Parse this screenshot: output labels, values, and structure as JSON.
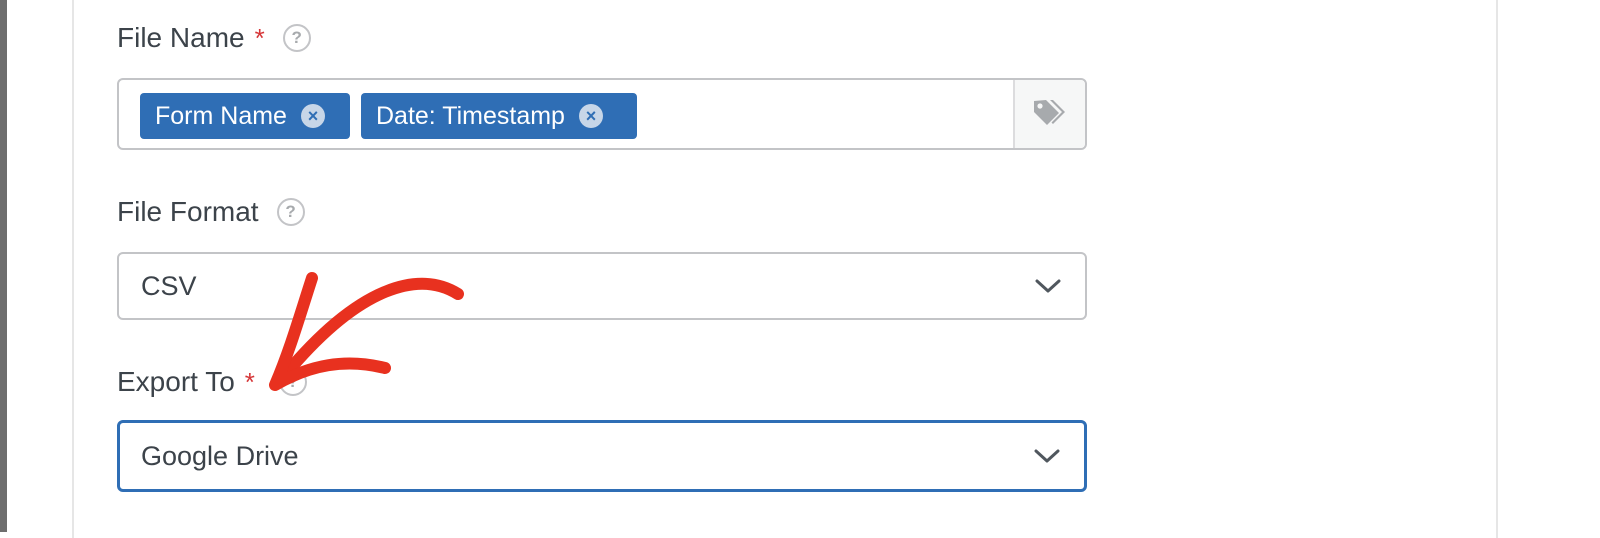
{
  "file_name": {
    "label": "File Name",
    "required_mark": "*",
    "help_icon": "question-circle-icon",
    "tags": [
      {
        "label": "Form Name",
        "remove_icon": "close-circle-icon"
      },
      {
        "label": "Date: Timestamp",
        "remove_icon": "close-circle-icon"
      }
    ],
    "smart_tag_icon": "tag-icon"
  },
  "file_format": {
    "label": "File Format",
    "help_icon": "question-circle-icon",
    "selected": "CSV",
    "dropdown_icon": "chevron-down-icon"
  },
  "export_to": {
    "label": "Export To",
    "required_mark": "*",
    "help_icon": "question-circle-icon",
    "selected": "Google Drive",
    "dropdown_icon": "chevron-down-icon"
  },
  "annotation": {
    "icon": "red-arrow",
    "color": "#e8311f"
  },
  "colors": {
    "tag_bg": "#2f6eb5",
    "focus_border": "#2f6eb5",
    "required": "#d63638"
  }
}
